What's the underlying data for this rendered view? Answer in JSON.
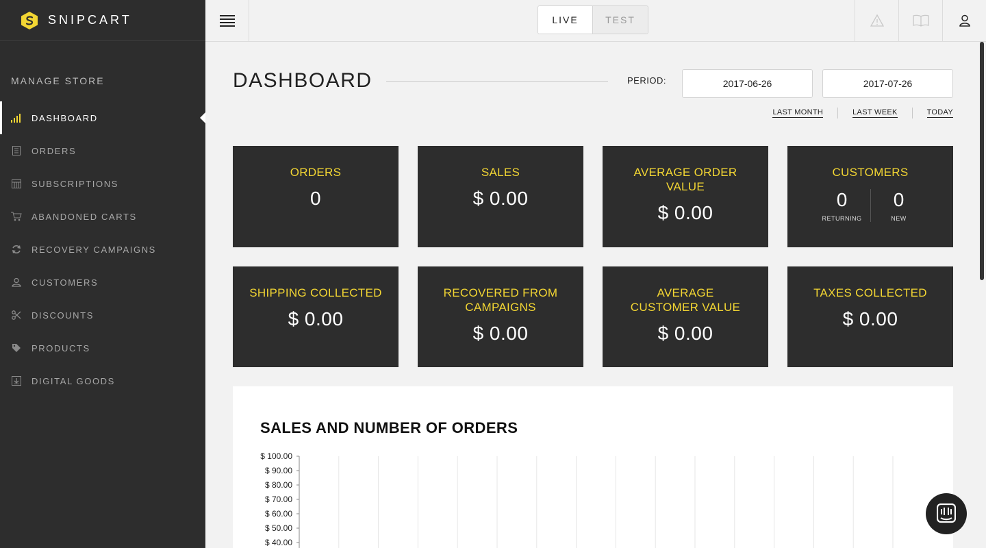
{
  "brand": {
    "name": "SNIPCART",
    "logo_icon": "snipcart-logo-icon",
    "accent": "#f3d633"
  },
  "sidebar": {
    "section_title": "MANAGE STORE",
    "items": [
      {
        "label": "DASHBOARD",
        "icon": "bar-chart-icon",
        "active": true
      },
      {
        "label": "ORDERS",
        "icon": "receipt-icon"
      },
      {
        "label": "SUBSCRIPTIONS",
        "icon": "calendar-icon"
      },
      {
        "label": "ABANDONED CARTS",
        "icon": "cart-icon"
      },
      {
        "label": "RECOVERY CAMPAIGNS",
        "icon": "refresh-icon"
      },
      {
        "label": "CUSTOMERS",
        "icon": "user-icon"
      },
      {
        "label": "DISCOUNTS",
        "icon": "scissors-icon"
      },
      {
        "label": "PRODUCTS",
        "icon": "tag-icon"
      },
      {
        "label": "DIGITAL GOODS",
        "icon": "download-icon"
      }
    ]
  },
  "topbar": {
    "mode_live": "LIVE",
    "mode_test": "TEST",
    "active_mode": "LIVE",
    "icons": [
      "warning-icon",
      "book-icon",
      "user-icon"
    ]
  },
  "dashboard": {
    "title": "DASHBOARD",
    "period_label": "PERIOD:",
    "start_date": "2017-06-26",
    "end_date": "2017-07-26",
    "quick_ranges": [
      "LAST MONTH",
      "LAST WEEK",
      "TODAY"
    ]
  },
  "cards": {
    "orders": {
      "title": "ORDERS",
      "value": "0"
    },
    "sales": {
      "title": "SALES",
      "value": "$ 0.00"
    },
    "avg_order": {
      "title": "AVERAGE ORDER VALUE",
      "value": "$ 0.00"
    },
    "customers": {
      "title": "CUSTOMERS",
      "returning": "0",
      "returning_label": "RETURNING",
      "new": "0",
      "new_label": "NEW"
    },
    "shipping": {
      "title": "SHIPPING COLLECTED",
      "value": "$ 0.00"
    },
    "recovered": {
      "title": "RECOVERED FROM CAMPAIGNS",
      "value": "$ 0.00"
    },
    "avg_customer": {
      "title": "AVERAGE CUSTOMER VALUE",
      "value": "$ 0.00"
    },
    "taxes": {
      "title": "TAXES COLLECTED",
      "value": "$ 0.00"
    }
  },
  "chart_data": {
    "type": "line",
    "title": "SALES AND NUMBER OF ORDERS",
    "ylim": [
      0,
      100
    ],
    "y_ticks": [
      "$ 100.00",
      "$ 90.00",
      "$ 80.00",
      "$ 70.00",
      "$ 60.00",
      "$ 50.00",
      "$ 40.00"
    ],
    "y_tick_values": [
      100,
      90,
      80,
      70,
      60,
      50,
      40
    ],
    "grid": "vertical",
    "x_categories": 15
  }
}
